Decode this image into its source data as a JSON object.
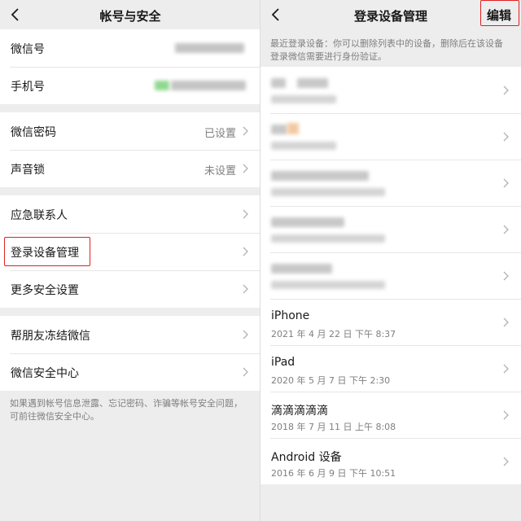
{
  "account_security": {
    "title": "帐号与安全",
    "wechat_id_label": "微信号",
    "phone_label": "手机号",
    "password_label": "微信密码",
    "password_value": "已设置",
    "voice_lock_label": "声音锁",
    "voice_lock_value": "未设置",
    "emergency_contacts_label": "应急联系人",
    "login_devices_label": "登录设备管理",
    "more_security_label": "更多安全设置",
    "help_unfreeze_label": "帮朋友冻结微信",
    "security_center_label": "微信安全中心",
    "footer_note": "如果遇到帐号信息泄露、忘记密码、诈骗等帐号安全问题，可前往微信安全中心。"
  },
  "login_devices": {
    "title": "登录设备管理",
    "edit_label": "编辑",
    "hint": "最近登录设备：你可以删除列表中的设备，删除后在该设备登录微信需要进行身份验证。",
    "devices": [
      {
        "name": "iPhone",
        "time": "2021 年 4 月 22 日  下午 8:37"
      },
      {
        "name": "iPad",
        "time": "2020 年 5 月 7 日  下午 2:30"
      },
      {
        "name": "滴滴滴滴滴",
        "time": "2018 年 7 月 11 日  上午 8:08"
      },
      {
        "name": "Android 设备",
        "time": "2016 年 6 月 9 日  下午 10:51"
      }
    ]
  },
  "icons": {
    "back": "back-arrow-icon",
    "chevron": "chevron-right-icon"
  },
  "colors": {
    "background": "#ededed",
    "card": "#ffffff",
    "secondary_text": "#7f7f7f",
    "highlight": "#e02020",
    "blur_green": "#8fd88f",
    "blur_orange": "#f2c9a0"
  }
}
